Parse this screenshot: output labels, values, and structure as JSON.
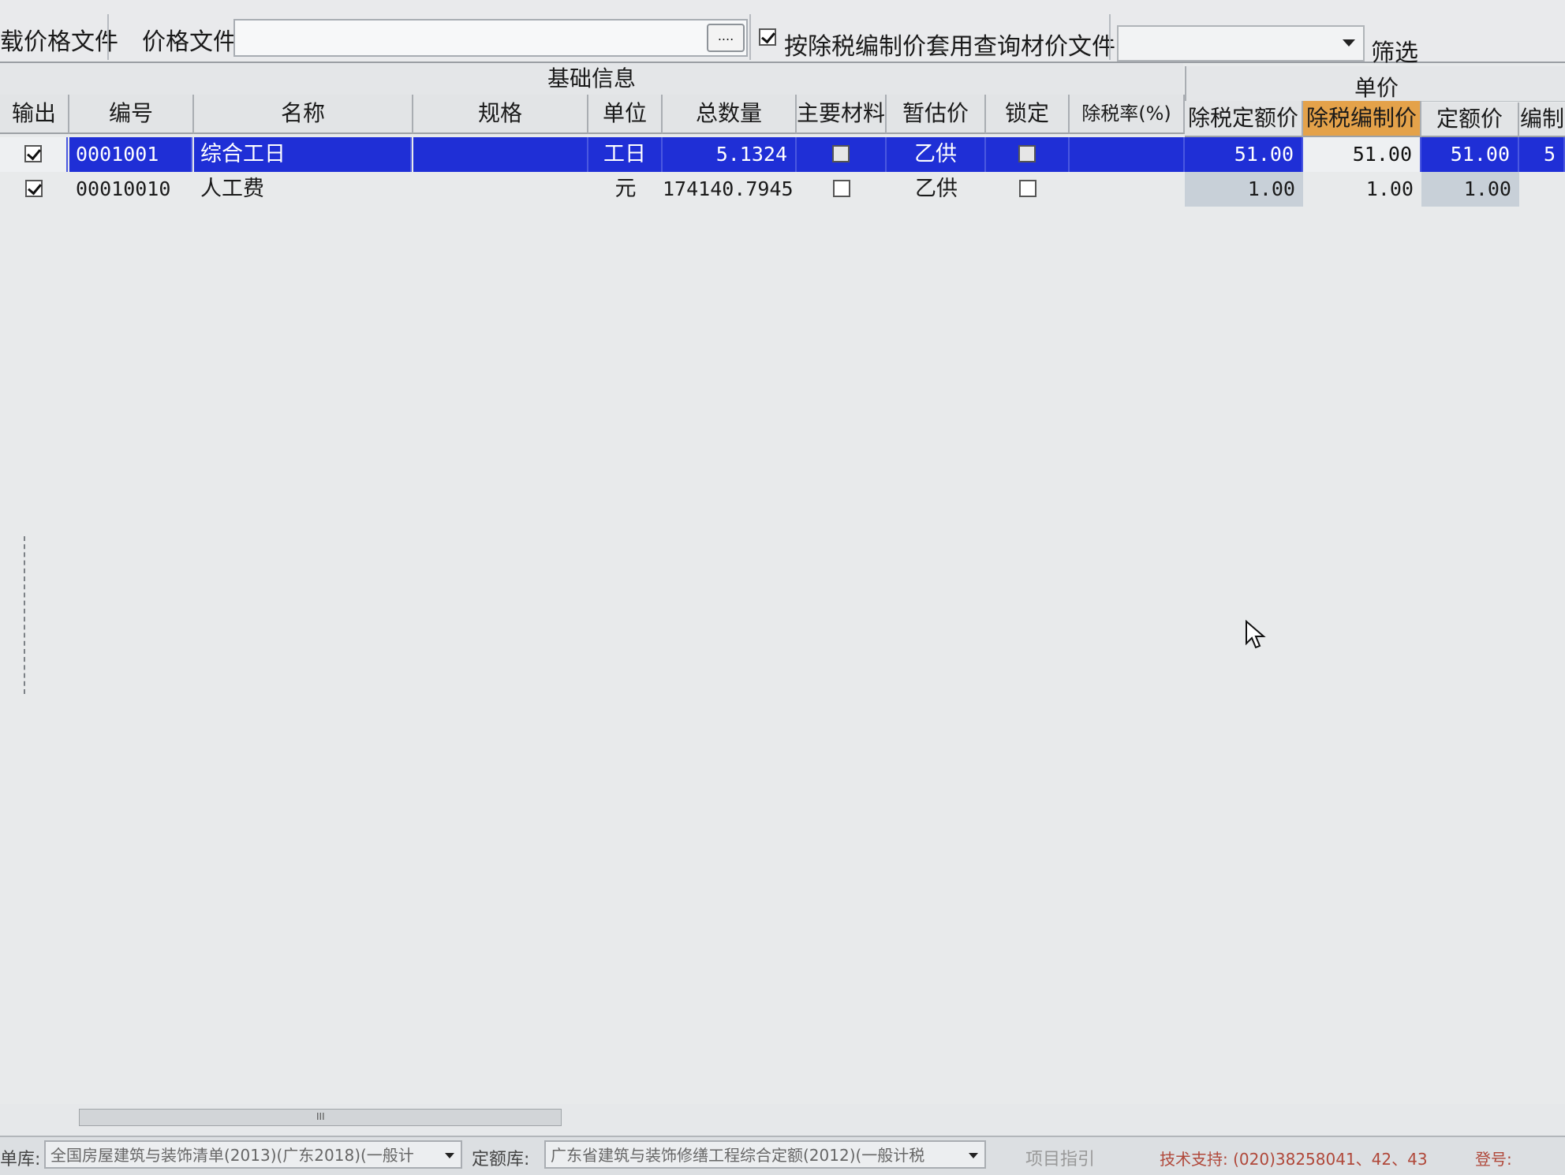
{
  "toolbar": {
    "left_label": "载价格文件",
    "pricefile_label": "价格文件",
    "pricefile_value": "",
    "browse_label": "....",
    "apply_excl_tax_checked": true,
    "apply_excl_tax_label": "按除税编制价套用",
    "query_label": "查询材价文件",
    "query_value": "",
    "filter_label": "筛选"
  },
  "grid": {
    "group_basic": "基础信息",
    "group_price": "单价",
    "columns": [
      "输出",
      "编号",
      "名称",
      "规格",
      "单位",
      "总数量",
      "主要材料",
      "暂估价",
      "锁定",
      "除税率(%)",
      "除税定额价",
      "除税编制价",
      "定额价",
      "编制"
    ],
    "rows": [
      {
        "output": true,
        "code": "0001001",
        "name": "综合工日",
        "spec": "",
        "unit": "工日",
        "qty": "5.1324",
        "main_material": false,
        "est": "乙供",
        "lock": false,
        "tax_rate": "",
        "excl_quota": "51.00",
        "excl_compile": "51.00",
        "quota": "51.00",
        "compile": "5"
      },
      {
        "output": true,
        "code": "00010010",
        "name": "人工费",
        "spec": "",
        "unit": "元",
        "qty": "174140.7945",
        "main_material": false,
        "est": "乙供",
        "lock": false,
        "tax_rate": "",
        "excl_quota": "1.00",
        "excl_compile": "1.00",
        "quota": "1.00",
        "compile": ""
      }
    ]
  },
  "scrollbar": {
    "grip": "III"
  },
  "statusbar": {
    "lib_label": "单库:",
    "lib_value": "全国房屋建筑与装饰清单(2013)(广东2018)(一般计",
    "quota_label": "定额库:",
    "quota_value": "广东省建筑与装饰修缮工程综合定额(2012)(一般计税",
    "hint": "项目指引",
    "tech_support": "技术支持: (020)38258041、42、43",
    "login_label": "登号:"
  },
  "colors": {
    "selection": "#1f2fd6",
    "highlight_header": "#e4a24a",
    "tech_text": "#b0483a"
  }
}
